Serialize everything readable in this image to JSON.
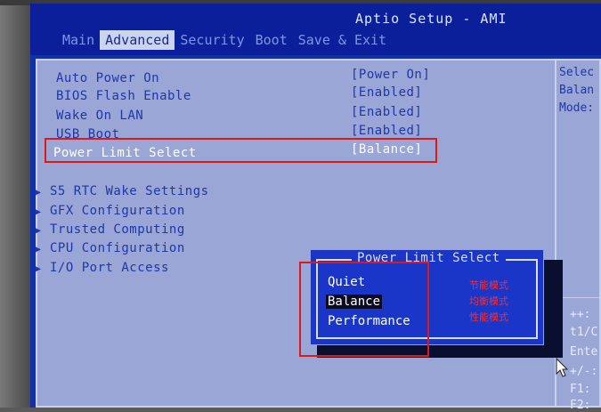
{
  "app_title": "Aptio Setup - AMI",
  "menu": {
    "tabs": [
      "Main",
      "Advanced",
      "Security",
      "Boot",
      "Save & Exit"
    ],
    "active": "Advanced"
  },
  "settings": [
    {
      "label": "Auto Power On",
      "value": "[Power On]"
    },
    {
      "label": "BIOS Flash Enable",
      "value": "[Enabled]"
    },
    {
      "label": "Wake On LAN",
      "value": "[Enabled]"
    },
    {
      "label": "USB Boot",
      "value": "[Enabled]"
    },
    {
      "label": "Power Limit Select",
      "value": "[Balance]",
      "selected": true
    }
  ],
  "submenus": [
    "S5 RTC Wake Settings",
    "GFX Configuration",
    "Trusted Computing",
    "CPU Configuration",
    "I/O Port Access"
  ],
  "help": {
    "lines": [
      "Selec",
      "Balan",
      "Mode:"
    ],
    "keys": [
      "++:",
      "t1/C",
      "Ente",
      "+/-:",
      "F1:",
      "F2:"
    ]
  },
  "popup": {
    "title": "Power Limit Select",
    "options": [
      "Quiet",
      "Balance",
      "Performance"
    ],
    "selected": "Balance",
    "annotations": [
      "节能模式",
      "均衡模式",
      "性能模式"
    ]
  },
  "colors": {
    "screen_bg": "#1230a8",
    "panel_bg": "#9aa6d6",
    "popup_bg": "#1a36c8",
    "annotation": "#e01818"
  }
}
